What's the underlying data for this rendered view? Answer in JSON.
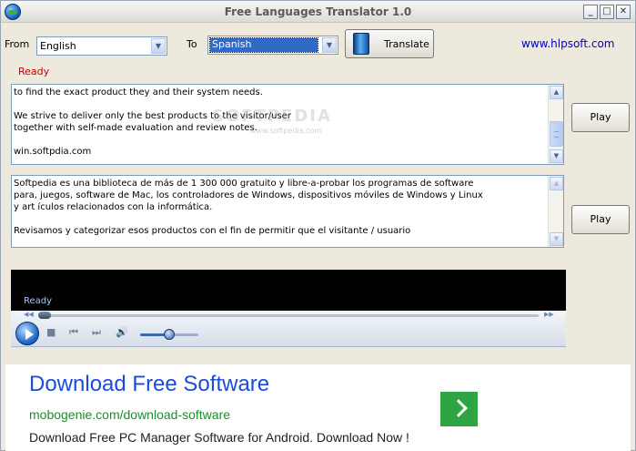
{
  "window": {
    "title": "Free Languages Translator 1.0",
    "controls": {
      "minimize": "_",
      "maximize": "□",
      "close": "✕"
    }
  },
  "toolbar": {
    "from_label": "From",
    "from_value": "English",
    "to_label": "To",
    "to_value": "Spanish",
    "translate_label": "Translate",
    "site_link": "www.hlpsoft.com"
  },
  "status": {
    "text": "Ready"
  },
  "source_text": {
    "content": "to find the exact product they and their system needs.\n\nWe strive to deliver only the best products to the visitor/user\ntogether with self-made evaluation and review notes.\n\nwin.softpdia.com",
    "play_label": "Play"
  },
  "translated_text": {
    "content": "Softpedia es una biblioteca de más de 1 300 000 gratuito y libre-a-probar los programas de software\npara, juegos, software de Mac, los controladores de Windows, dispositivos móviles de Windows y Linux\ny art ículos relacionados con la informática.\n\nRevisamos y categorizar esos productos con el fin de permitir que el visitante / usuario",
    "play_label": "Play"
  },
  "player": {
    "status": "Ready",
    "volume_fraction": 0.5,
    "seek_fraction": 0.0
  },
  "ad": {
    "title": "Download Free Software",
    "url": "mobogenie.com/download-software",
    "description": "Download Free PC Manager Software for Android. Download Now !"
  },
  "icons": [
    "app-globe-icon",
    "dropdown-arrow-icon",
    "book-icon",
    "play-icon",
    "stop-icon",
    "previous-icon",
    "next-icon",
    "volume-icon",
    "chevron-right-icon"
  ],
  "colors": {
    "status_red": "#c00000",
    "link_blue": "#0000cc",
    "ad_green": "#2fa443",
    "ad_title_blue": "#1a4bdb"
  }
}
